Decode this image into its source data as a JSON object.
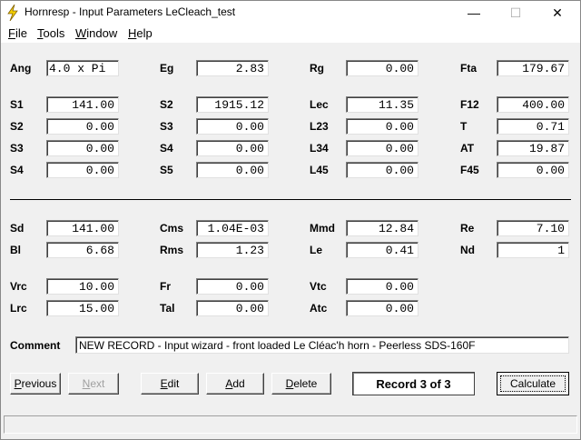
{
  "window": {
    "title": "Hornresp - Input Parameters   LeCleach_test",
    "minimize_glyph": "—",
    "maximize_glyph": "☐",
    "close_glyph": "✕"
  },
  "menu": [
    "File",
    "Tools",
    "Window",
    "Help"
  ],
  "params": {
    "Ang": "4.0 x Pi",
    "Eg": "2.83",
    "Rg": "0.00",
    "Fta": "179.67",
    "S1": "141.00",
    "S2a": "1915.12",
    "Lec": "11.35",
    "F12": "400.00",
    "S2": "0.00",
    "S3a": "0.00",
    "L23": "0.00",
    "T": "0.71",
    "S3": "0.00",
    "S4a": "0.00",
    "L34": "0.00",
    "AT": "19.87",
    "S4": "0.00",
    "S5": "0.00",
    "L45": "0.00",
    "F45": "0.00",
    "Sd": "141.00",
    "Cms": "1.04E-03",
    "Mmd": "12.84",
    "Re": "7.10",
    "Bl": "6.68",
    "Rms": "1.23",
    "Le": "0.41",
    "Nd": "1",
    "Vrc": "10.00",
    "Fr": "0.00",
    "Vtc": "0.00",
    "Lrc": "15.00",
    "Tal": "0.00",
    "Atc": "0.00"
  },
  "labels": {
    "Ang": "Ang",
    "Eg": "Eg",
    "Rg": "Rg",
    "Fta": "Fta",
    "S1": "S1",
    "S2a": "S2",
    "Lec": "Lec",
    "F12": "F12",
    "S2": "S2",
    "S3a": "S3",
    "L23": "L23",
    "T": "T",
    "S3": "S3",
    "S4a": "S4",
    "L34": "L34",
    "AT": "AT",
    "S4": "S4",
    "S5": "S5",
    "L45": "L45",
    "F45": "F45",
    "Sd": "Sd",
    "Cms": "Cms",
    "Mmd": "Mmd",
    "Re": "Re",
    "Bl": "Bl",
    "Rms": "Rms",
    "Le": "Le",
    "Nd": "Nd",
    "Vrc": "Vrc",
    "Fr": "Fr",
    "Vtc": "Vtc",
    "Lrc": "Lrc",
    "Tal": "Tal",
    "Atc": "Atc"
  },
  "comment": {
    "label": "Comment",
    "value": "NEW RECORD - Input wizard - front loaded Le Cléac'h horn - Peerless SDS-160F"
  },
  "buttons": {
    "previous": "Previous",
    "next": "Next",
    "edit": "Edit",
    "add": "Add",
    "delete": "Delete",
    "calculate": "Calculate"
  },
  "record_status": "Record 3 of 3",
  "colors": {
    "window_bg": "#f0f0f0",
    "icon_yellow": "#f5d000"
  }
}
